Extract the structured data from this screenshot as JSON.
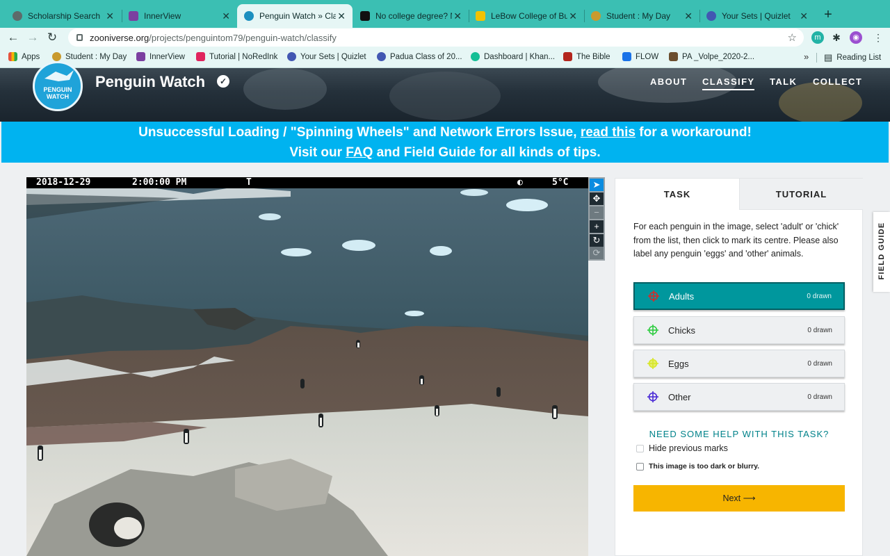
{
  "browser": {
    "tabs": [
      {
        "title": "Scholarship Search",
        "favicon_color": "#5d6b6a"
      },
      {
        "title": "InnerView",
        "favicon_color": "#7b3fa0"
      },
      {
        "title": "Penguin Watch » Cla",
        "favicon_color": "#1c8fbf"
      },
      {
        "title": "No college degree? N",
        "favicon_color": "#111111"
      },
      {
        "title": "LeBow College of Bus",
        "favicon_color": "#f2c200"
      },
      {
        "title": "Student : My Day",
        "favicon_color": "#c99a2e"
      },
      {
        "title": "Your Sets | Quizlet",
        "favicon_color": "#4257b2"
      }
    ],
    "url_host": "zooniverse.org",
    "url_path": "/projects/penguintom79/penguin-watch/classify",
    "extensions": [
      "m",
      "✱",
      "◉"
    ],
    "bookmarks": [
      {
        "label": "Apps",
        "favicon_color": "#e5533d"
      },
      {
        "label": "Student : My Day",
        "favicon_color": "#c99a2e"
      },
      {
        "label": "InnerView",
        "favicon_color": "#7b3fa0"
      },
      {
        "label": "Tutorial | NoRedInk",
        "favicon_color": "#e0245e"
      },
      {
        "label": "Your Sets | Quizlet",
        "favicon_color": "#4257b2"
      },
      {
        "label": "Padua Class of 20...",
        "favicon_color": "#4257b2"
      },
      {
        "label": "Dashboard | Khan...",
        "favicon_color": "#14bf96"
      },
      {
        "label": "The Bible",
        "favicon_color": "#b3261e"
      },
      {
        "label": "FLOW",
        "favicon_color": "#1a73e8"
      },
      {
        "label": "PA _Volpe_2020-2...",
        "favicon_color": "#6b4e2e"
      }
    ],
    "bookmarks_more": "»",
    "reading_list": "Reading List"
  },
  "site": {
    "logo_line1": "PENGUIN",
    "logo_line2": "WATCH",
    "project_title": "Penguin Watch",
    "verified_icon": "✓",
    "nav": [
      "ABOUT",
      "CLASSIFY",
      "TALK",
      "COLLECT"
    ],
    "active_nav": "CLASSIFY"
  },
  "banner": {
    "line1_pre": "Unsuccessful Loading / \"Spinning Wheels\" and Network Errors Issue, ",
    "line1_link": "read this",
    "line1_post": " for a workaround!",
    "line2_pre": "Visit our ",
    "line2_link": "FAQ",
    "line2_post": " and Field Guide for all kinds of tips."
  },
  "subject": {
    "date": "2018-12-29",
    "time": "2:00:00 PM",
    "flag": "T",
    "moon_icon": "◐",
    "temperature": "5°C"
  },
  "tools": [
    {
      "name": "select-pointer-tool",
      "glyph": "➤"
    },
    {
      "name": "move-tool",
      "glyph": "✥"
    },
    {
      "name": "zoom-out-tool",
      "glyph": "−"
    },
    {
      "name": "zoom-in-tool",
      "glyph": "+"
    },
    {
      "name": "rotate-tool",
      "glyph": "↻"
    },
    {
      "name": "reset-tool",
      "glyph": "⟳"
    }
  ],
  "task": {
    "tabs": [
      "TASK",
      "TUTORIAL"
    ],
    "instructions": "For each penguin in the image, select 'adult' or 'chick' from the list, then click to mark its centre. Please also label any penguin 'eggs' and 'other' animals.",
    "choices": [
      {
        "label": "Adults",
        "count": "0 drawn",
        "color": "#d62b2b",
        "selected": true
      },
      {
        "label": "Chicks",
        "count": "0 drawn",
        "color": "#2ecc40",
        "selected": false
      },
      {
        "label": "Eggs",
        "count": "0 drawn",
        "color": "#d8e62b",
        "selected": false
      },
      {
        "label": "Other",
        "count": "0 drawn",
        "color": "#4b2bd6",
        "selected": false
      }
    ],
    "help_link": "NEED SOME HELP WITH THIS TASK?",
    "hide_marks": "Hide previous marks",
    "too_dark": "This image is too dark or blurry.",
    "next": "Next ⟶"
  },
  "field_guide": "FIELD GUIDE",
  "colors": {
    "chrome": "#3bbfb3",
    "banner": "#00b3f0",
    "selected_choice": "#00979d",
    "next_button": "#f7b500",
    "help_text": "#00828a"
  }
}
